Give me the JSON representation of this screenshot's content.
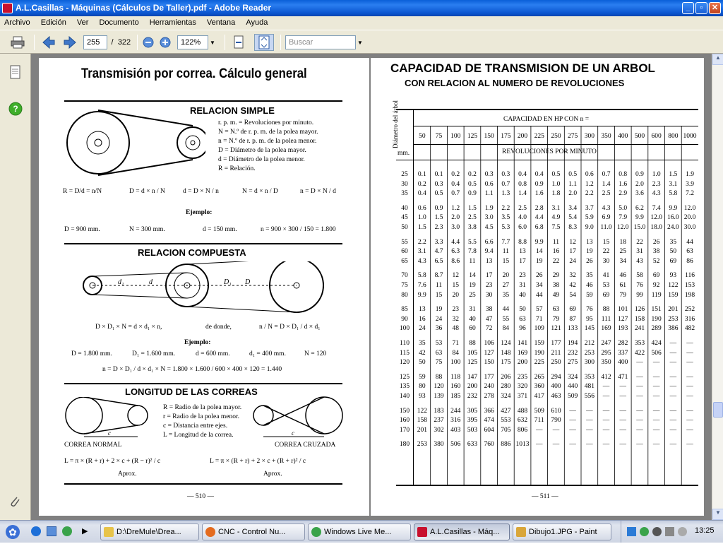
{
  "window": {
    "title": "A.L.Casillas - Máquinas (Cálculos De Taller).pdf - Adobe Reader"
  },
  "menu": [
    "Archivo",
    "Edición",
    "Ver",
    "Documento",
    "Herramientas",
    "Ventana",
    "Ayuda"
  ],
  "toolbar": {
    "page_current": "255",
    "page_sep": "/",
    "page_total": "322",
    "zoom": "122%",
    "search_placeholder": "Buscar"
  },
  "page1": {
    "title": "Transmisión por correa.  Cálculo general",
    "simple": {
      "heading": "RELACION SIMPLE",
      "legend": [
        "r. p. m. = Revoluciones por minuto.",
        "N = N.º de r. p. m. de la polea mayor.",
        "n = N.º de r. p. m. de la polea menor.",
        "D = Diámetro de la polea mayor.",
        "d = Diámetro de la polea menor.",
        "R = Relación."
      ],
      "formulas": [
        "R = D/d = n/N",
        "D = d × n / N",
        "d = D × N / n",
        "N = d × n / D",
        "n = D × N / d"
      ],
      "example_label": "Ejemplo:",
      "example": [
        "D = 900 mm.",
        "N = 300 mm.",
        "d = 150 mm.",
        "n = 900 × 300 / 150 = 1.800"
      ]
    },
    "compound": {
      "heading": "RELACION COMPUESTA",
      "labels": [
        "d",
        "d",
        "D",
        "D"
      ],
      "formula": "D × D₁ × N = d × d₁ × n,",
      "de_donde": "de donde,",
      "ratio": "n / N = D × D₁ / d × d₁",
      "example_label": "Ejemplo:",
      "example": [
        "D = 1.800 mm.",
        "D₁ = 1.600 mm.",
        "d = 600 mm.",
        "d₁ = 400 mm.",
        "N = 120"
      ],
      "result": "n = D × D₁ / d × d₁ × N = 1.800 × 1.600 / 600 × 400 × 120 = 1.440"
    },
    "belts": {
      "heading": "LONGITUD DE LAS CORREAS",
      "legend": [
        "R = Radio de la polea mayor.",
        "r = Radio de la polea menor.",
        "c = Distancia entre ejes.",
        "L = Longitud de la correa."
      ],
      "normal": "CORREA NORMAL",
      "crossed": "CORREA CRUZADA",
      "f_normal": "L = π × (R + r) + 2 × c + (R − r)² / c",
      "f_crossed": "L = π × (R + r) + 2 × c + (R + r)² / c",
      "aprox": "Aprox."
    },
    "page_number": "— 510 —"
  },
  "page2": {
    "title1": "CAPACIDAD DE TRANSMISION DE UN ARBOL",
    "title2": "CON RELACION AL NUMERO DE REVOLUCIONES",
    "diam_header": "Diámetro del árbol",
    "mm": "mm.",
    "cap_header": "CAPACIDAD EN HP CON n =",
    "rev_header": "REVOLUCIONES POR MINUTO",
    "columns": [
      "50",
      "75",
      "100",
      "125",
      "150",
      "175",
      "200",
      "225",
      "250",
      "275",
      "300",
      "350",
      "400",
      "500",
      "600",
      "800",
      "1000"
    ],
    "rows": [
      {
        "d": "25",
        "v": [
          "0.1",
          "0.1",
          "0.2",
          "0.2",
          "0.3",
          "0.3",
          "0.4",
          "0.4",
          "0.5",
          "0.5",
          "0.6",
          "0.7",
          "0.8",
          "0.9",
          "1.0",
          "1.5",
          "1.9"
        ]
      },
      {
        "d": "30",
        "v": [
          "0.2",
          "0.3",
          "0.4",
          "0.5",
          "0.6",
          "0.7",
          "0.8",
          "0.9",
          "1.0",
          "1.1",
          "1.2",
          "1.4",
          "1.6",
          "2.0",
          "2.3",
          "3.1",
          "3.9"
        ]
      },
      {
        "d": "35",
        "v": [
          "0.4",
          "0.5",
          "0.7",
          "0.9",
          "1.1",
          "1.3",
          "1.4",
          "1.6",
          "1.8",
          "2.0",
          "2.2",
          "2.5",
          "2.9",
          "3.6",
          "4.3",
          "5.8",
          "7.2"
        ]
      },
      {
        "d": "40",
        "v": [
          "0.6",
          "0.9",
          "1.2",
          "1.5",
          "1.9",
          "2.2",
          "2.5",
          "2.8",
          "3.1",
          "3.4",
          "3.7",
          "4.3",
          "5.0",
          "6.2",
          "7.4",
          "9.9",
          "12.0"
        ]
      },
      {
        "d": "45",
        "v": [
          "1.0",
          "1.5",
          "2.0",
          "2.5",
          "3.0",
          "3.5",
          "4.0",
          "4.4",
          "4.9",
          "5.4",
          "5.9",
          "6.9",
          "7.9",
          "9.9",
          "12.0",
          "16.0",
          "20.0"
        ]
      },
      {
        "d": "50",
        "v": [
          "1.5",
          "2.3",
          "3.0",
          "3.8",
          "4.5",
          "5.3",
          "6.0",
          "6.8",
          "7.5",
          "8.3",
          "9.0",
          "11.0",
          "12.0",
          "15.0",
          "18.0",
          "24.0",
          "30.0"
        ]
      },
      {
        "d": "55",
        "v": [
          "2.2",
          "3.3",
          "4.4",
          "5.5",
          "6.6",
          "7.7",
          "8.8",
          "9.9",
          "11",
          "12",
          "13",
          "15",
          "18",
          "22",
          "26",
          "35",
          "44"
        ]
      },
      {
        "d": "60",
        "v": [
          "3.1",
          "4.7",
          "6.3",
          "7.8",
          "9.4",
          "11",
          "13",
          "14",
          "16",
          "17",
          "19",
          "22",
          "25",
          "31",
          "38",
          "50",
          "63"
        ]
      },
      {
        "d": "65",
        "v": [
          "4.3",
          "6.5",
          "8.6",
          "11",
          "13",
          "15",
          "17",
          "19",
          "22",
          "24",
          "26",
          "30",
          "34",
          "43",
          "52",
          "69",
          "86"
        ]
      },
      {
        "d": "70",
        "v": [
          "5.8",
          "8.7",
          "12",
          "14",
          "17",
          "20",
          "23",
          "26",
          "29",
          "32",
          "35",
          "41",
          "46",
          "58",
          "69",
          "93",
          "116"
        ]
      },
      {
        "d": "75",
        "v": [
          "7.6",
          "11",
          "15",
          "19",
          "23",
          "27",
          "31",
          "34",
          "38",
          "42",
          "46",
          "53",
          "61",
          "76",
          "92",
          "122",
          "153"
        ]
      },
      {
        "d": "80",
        "v": [
          "9.9",
          "15",
          "20",
          "25",
          "30",
          "35",
          "40",
          "44",
          "49",
          "54",
          "59",
          "69",
          "79",
          "99",
          "119",
          "159",
          "198"
        ]
      },
      {
        "d": "85",
        "v": [
          "13",
          "19",
          "23",
          "31",
          "38",
          "44",
          "50",
          "57",
          "63",
          "69",
          "76",
          "88",
          "101",
          "126",
          "151",
          "201",
          "252"
        ]
      },
      {
        "d": "90",
        "v": [
          "16",
          "24",
          "32",
          "40",
          "47",
          "55",
          "63",
          "71",
          "79",
          "87",
          "95",
          "111",
          "127",
          "158",
          "190",
          "253",
          "316"
        ]
      },
      {
        "d": "100",
        "v": [
          "24",
          "36",
          "48",
          "60",
          "72",
          "84",
          "96",
          "109",
          "121",
          "133",
          "145",
          "169",
          "193",
          "241",
          "289",
          "386",
          "482"
        ]
      },
      {
        "d": "110",
        "v": [
          "35",
          "53",
          "71",
          "88",
          "106",
          "124",
          "141",
          "159",
          "177",
          "194",
          "212",
          "247",
          "282",
          "353",
          "424",
          "—",
          "—"
        ]
      },
      {
        "d": "115",
        "v": [
          "42",
          "63",
          "84",
          "105",
          "127",
          "148",
          "169",
          "190",
          "211",
          "232",
          "253",
          "295",
          "337",
          "422",
          "506",
          "—",
          "—"
        ]
      },
      {
        "d": "120",
        "v": [
          "50",
          "75",
          "100",
          "125",
          "150",
          "175",
          "200",
          "225",
          "250",
          "275",
          "300",
          "350",
          "400",
          "—",
          "—",
          "—",
          "—"
        ]
      },
      {
        "d": "125",
        "v": [
          "59",
          "88",
          "118",
          "147",
          "177",
          "206",
          "235",
          "265",
          "294",
          "324",
          "353",
          "412",
          "471",
          "—",
          "—",
          "—",
          "—"
        ]
      },
      {
        "d": "135",
        "v": [
          "80",
          "120",
          "160",
          "200",
          "240",
          "280",
          "320",
          "360",
          "400",
          "440",
          "481",
          "—",
          "—",
          "—",
          "—",
          "—",
          "—"
        ]
      },
      {
        "d": "140",
        "v": [
          "93",
          "139",
          "185",
          "232",
          "278",
          "324",
          "371",
          "417",
          "463",
          "509",
          "556",
          "—",
          "—",
          "—",
          "—",
          "—",
          "—"
        ]
      },
      {
        "d": "150",
        "v": [
          "122",
          "183",
          "244",
          "305",
          "366",
          "427",
          "488",
          "509",
          "610",
          "—",
          "—",
          "—",
          "—",
          "—",
          "—",
          "—",
          "—"
        ]
      },
      {
        "d": "160",
        "v": [
          "158",
          "237",
          "316",
          "395",
          "474",
          "553",
          "632",
          "711",
          "790",
          "—",
          "—",
          "—",
          "—",
          "—",
          "—",
          "—",
          "—"
        ]
      },
      {
        "d": "170",
        "v": [
          "201",
          "302",
          "403",
          "503",
          "604",
          "705",
          "806",
          "—",
          "—",
          "—",
          "—",
          "—",
          "—",
          "—",
          "—",
          "—",
          "—"
        ]
      },
      {
        "d": "180",
        "v": [
          "253",
          "380",
          "506",
          "633",
          "760",
          "886",
          "1013",
          "—",
          "—",
          "—",
          "—",
          "—",
          "—",
          "—",
          "—",
          "—",
          "—"
        ]
      }
    ],
    "page_number": "— 511 —"
  },
  "taskbar": {
    "tasks": [
      {
        "label": "D:\\DreMule\\Drea...",
        "icon": "folder-icon",
        "color": "#e7c34a"
      },
      {
        "label": "CNC - Control Nu...",
        "icon": "firefox-icon",
        "color": "#e46b1f"
      },
      {
        "label": "Windows Live Me...",
        "icon": "messenger-icon",
        "color": "#3aa34a"
      },
      {
        "label": "A.L.Casillas - Máq...",
        "icon": "pdf-icon",
        "color": "#c8102e"
      },
      {
        "label": "Dibujo1.JPG - Paint",
        "icon": "paint-icon",
        "color": "#d9a63a"
      }
    ],
    "clock": "13:25"
  }
}
